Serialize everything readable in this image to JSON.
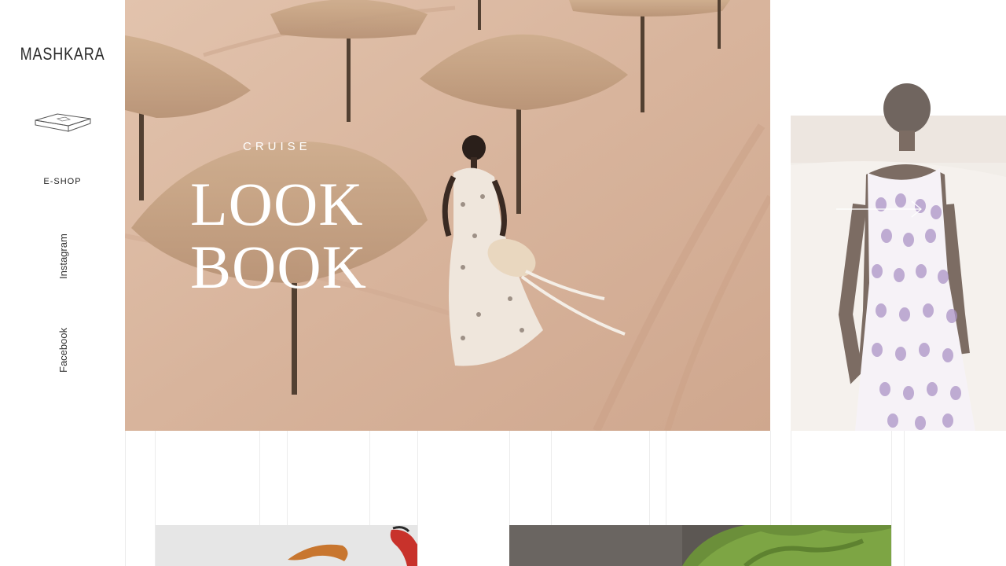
{
  "brand": {
    "logo": "MASHKARA"
  },
  "sidebar": {
    "cart_icon": "box-icon",
    "eshop_label": "E-SHOP",
    "instagram_label": "Instagram",
    "facebook_label": "Facebook"
  },
  "hero": {
    "kicker": "CRUISE",
    "title_line1": "LOOK",
    "title_line2": "BOOK"
  },
  "colors": {
    "sand": "#d9b7a1",
    "text_white": "#ffffff",
    "dark_text": "#222222",
    "grid_line": "#ececec"
  },
  "icons": {
    "next": "arrow-right-icon"
  }
}
